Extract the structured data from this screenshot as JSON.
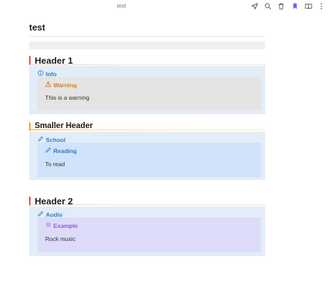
{
  "app": {
    "tab_title": "test"
  },
  "toolbar": {
    "icons": [
      "navigate-icon",
      "search-icon",
      "trash-icon",
      "bookmark-icon",
      "reading-mode-icon",
      "more-icon"
    ],
    "bookmark_color": "#7c5fe6"
  },
  "page": {
    "title": "test"
  },
  "sections": [
    {
      "heading": "Header 1",
      "accent": "#e04a4a",
      "callout": {
        "title": "Info",
        "icon": "info-icon",
        "inner": {
          "title": "Warning",
          "icon": "warning-icon",
          "body": "This is a warning",
          "bg": "#e4e4e4",
          "title_color": "#e07b13"
        }
      }
    },
    {
      "heading": "Smaller Header",
      "accent": "#f0a020",
      "callout": {
        "title": "School",
        "icon": "pencil-icon",
        "inner": {
          "title": "Reading",
          "icon": "pencil-icon",
          "body": "To read",
          "bg": "#d1e3fa",
          "title_color": "#2f79c8"
        }
      }
    },
    {
      "heading": "Header 2",
      "accent": "#e04a4a",
      "callout": {
        "title": "Audio",
        "icon": "pencil-icon",
        "inner": {
          "title": "Example",
          "icon": "list-icon",
          "body": "Rock music",
          "bg": "#dcdcf8",
          "title_color": "#8a5fd8"
        }
      }
    }
  ]
}
